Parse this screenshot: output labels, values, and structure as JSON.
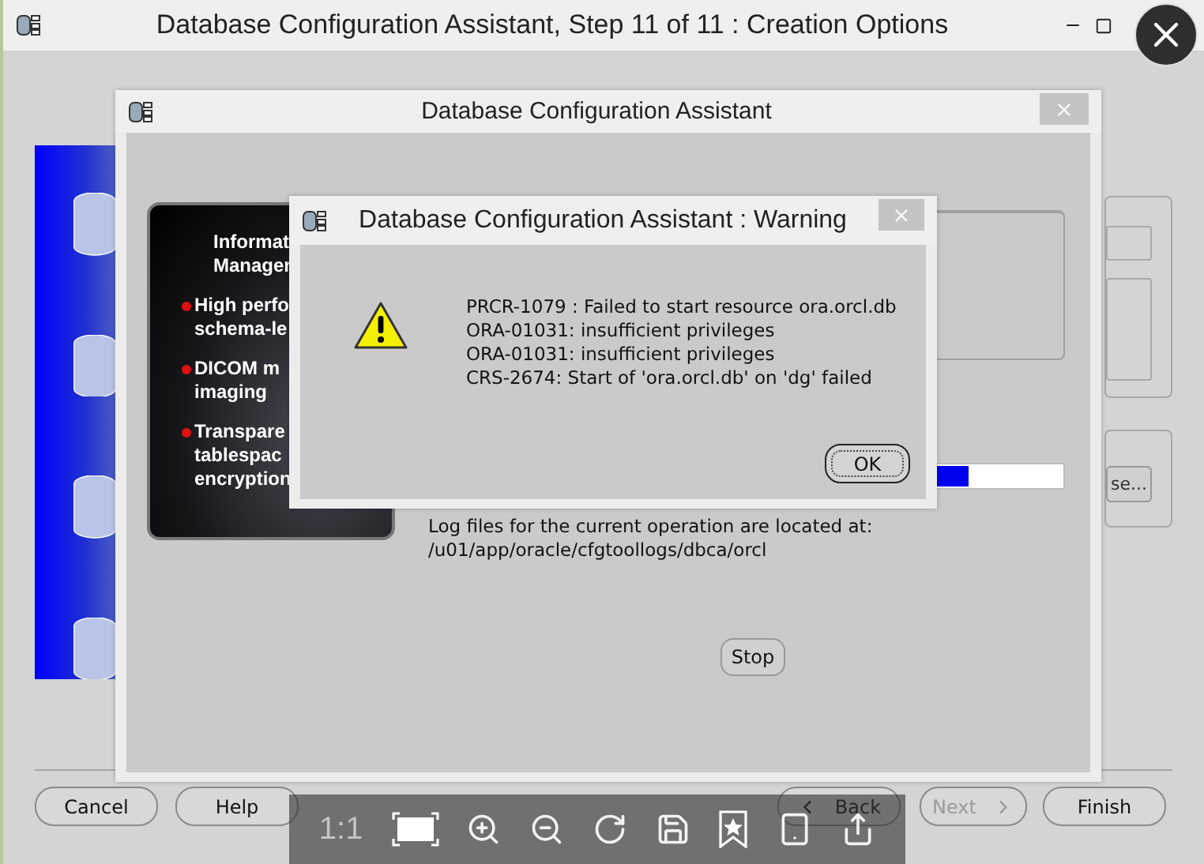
{
  "main_window": {
    "title": "Database Configuration Assistant, Step 11 of 11 : Creation Options",
    "partial_button": "se...",
    "buttons": [
      {
        "label": "Cancel",
        "kind": "plain",
        "disabled": false
      },
      {
        "label": "Help",
        "kind": "plain",
        "disabled": false
      },
      {
        "label": "Back",
        "kind": "back",
        "disabled": false
      },
      {
        "label": "Next",
        "kind": "next",
        "disabled": true
      },
      {
        "label": "Finish",
        "kind": "plain",
        "disabled": false
      }
    ]
  },
  "progress_dialog": {
    "title": "Database Configuration Assistant",
    "banner": {
      "heading": [
        "Informat",
        "Manager"
      ],
      "bullets": [
        [
          "High perfo",
          "schema-le"
        ],
        [
          "DICOM m",
          "imaging"
        ],
        [
          "Transpare",
          "tablespac",
          "encryption"
        ]
      ]
    },
    "progress": {
      "level": 0.85
    },
    "log_lines": [
      "Log files for the current operation are located at:",
      "/u01/app/oracle/cfgtoollogs/dbca/orcl"
    ],
    "stop_button": "Stop"
  },
  "warning_dialog": {
    "title": "Database Configuration Assistant : Warning",
    "messages": [
      "PRCR-1079 : Failed to start resource ora.orcl.db",
      "ORA-01031: insufficient privileges",
      "ORA-01031: insufficient privileges",
      "CRS-2674: Start of 'ora.orcl.db' on 'dg' failed"
    ],
    "ok_button": "OK"
  },
  "viewer_toolbar": {
    "zoom_label": "1:1"
  }
}
